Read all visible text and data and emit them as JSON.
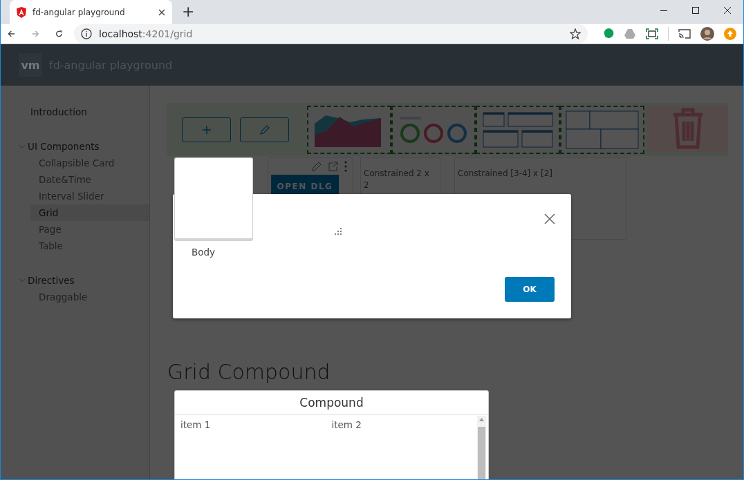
{
  "browser": {
    "tab_title": "fd-angular playground",
    "new_tab": "+",
    "url_host": "localhost",
    "url_path": ":4201/grid"
  },
  "header": {
    "logo": "vm",
    "title": "fd-angular playground"
  },
  "sidebar": {
    "items": [
      {
        "label": "Introduction",
        "selected": false
      },
      {
        "label": "UI Components",
        "expanded": true,
        "children": [
          {
            "label": "Collapsible Card",
            "selected": false
          },
          {
            "label": "Date&Time",
            "selected": false
          },
          {
            "label": "Interval Slider",
            "selected": false
          },
          {
            "label": "Grid",
            "selected": true
          },
          {
            "label": "Page",
            "selected": false
          },
          {
            "label": "Table",
            "selected": false
          }
        ]
      },
      {
        "label": "Directives",
        "expanded": true,
        "children": [
          {
            "label": "Draggable",
            "selected": false
          }
        ]
      }
    ]
  },
  "palette": {
    "thumbnails": [
      {
        "kind": "area-chart"
      },
      {
        "kind": "donuts"
      },
      {
        "kind": "layout"
      },
      {
        "kind": "grid"
      }
    ]
  },
  "tiles": [
    {
      "kind": "actions",
      "button": "OPEN DLG"
    },
    {
      "kind": "text",
      "label": "Constrained 2 x 2"
    },
    {
      "kind": "text",
      "label": "Constrained [3-4] x [2]"
    }
  ],
  "dialog": {
    "body": "Body",
    "ok": "OK"
  },
  "section": {
    "heading": "Grid Compound",
    "card": {
      "title": "Compound",
      "items": [
        "item 1",
        "item 2"
      ]
    }
  }
}
